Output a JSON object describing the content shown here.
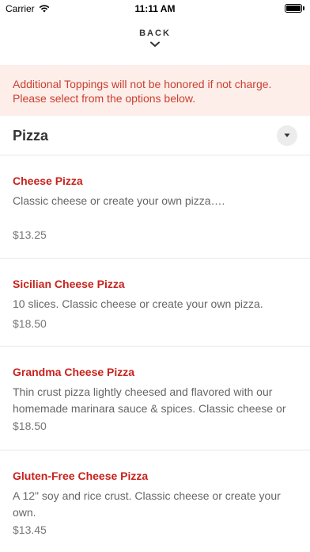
{
  "status_bar": {
    "carrier": "Carrier",
    "time": "11:11 AM",
    "battery_level": 1.0
  },
  "nav": {
    "back_label": "BACK",
    "chevron_icon": "chevron-down-icon"
  },
  "notice": {
    "text": "Additional Toppings will not be honored if not charge. Please select from the options below."
  },
  "section": {
    "title": "Pizza",
    "toggle_icon": "caret-down-icon"
  },
  "items": [
    {
      "name": "Cheese Pizza",
      "description": "Classic cheese or create your own pizza….",
      "price": "$13.25"
    },
    {
      "name": "Sicilian Cheese Pizza",
      "description": "10 slices. Classic cheese or create your own pizza.",
      "price": "$18.50"
    },
    {
      "name": "Grandma Cheese Pizza",
      "description": "Thin crust pizza lightly cheesed and flavored with our homemade marinara sauce & spices. Classic cheese or cr…",
      "price": "$18.50"
    },
    {
      "name": "Gluten-Free Cheese Pizza",
      "description": "A 12\" soy and rice crust. Classic cheese or create your own.",
      "price": "$13.45"
    }
  ],
  "colors": {
    "accent": "#c8221c",
    "notice_bg": "#fdeeea",
    "notice_text": "#c9402f"
  }
}
